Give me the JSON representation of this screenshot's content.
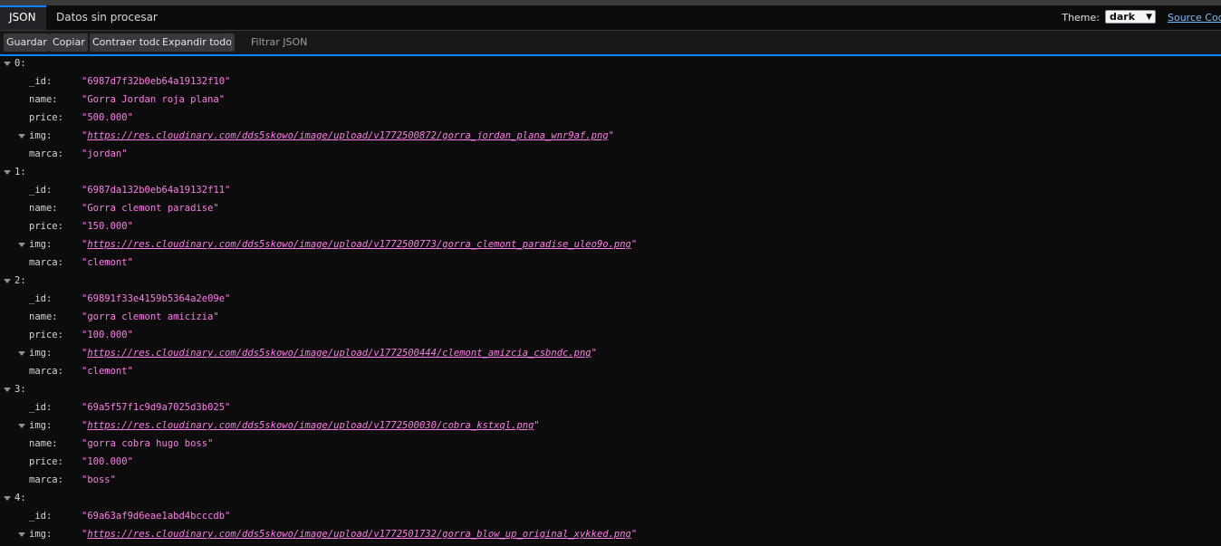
{
  "tabs": [
    {
      "label": "JSON",
      "active": true
    },
    {
      "label": "Datos sin procesar",
      "active": false
    }
  ],
  "header": {
    "theme_label": "Theme:",
    "theme_value": "dark",
    "source_link": "Source Code"
  },
  "toolbar": {
    "save_label": "Guardar",
    "copy_label": "Copiar",
    "collapse_label": "Contraer todo",
    "expand_label": "Expandir todo",
    "filter_placeholder": "Filtrar JSON"
  },
  "colors": {
    "accent": "#0a84ff",
    "string_value": "#ff7de9",
    "background": "#0c0c0d"
  },
  "items": [
    {
      "index": "0:",
      "fields": [
        {
          "key": "_id:",
          "value": "\"6987d7f32b0eb64a19132f10\"",
          "link": false
        },
        {
          "key": "name:",
          "value": "\"Gorra Jordan roja plana\"",
          "link": false
        },
        {
          "key": "price:",
          "value": "\"500.000\"",
          "link": false
        },
        {
          "key": "img:",
          "value": "https://res.cloudinary.com/dds5skowo/image/upload/v1772500872/gorra_jordan_plana_wnr9af.png",
          "link": true
        },
        {
          "key": "marca:",
          "value": "\"jordan\"",
          "link": false
        }
      ]
    },
    {
      "index": "1:",
      "fields": [
        {
          "key": "_id:",
          "value": "\"6987da132b0eb64a19132f11\"",
          "link": false
        },
        {
          "key": "name:",
          "value": "\"Gorra clemont paradise\"",
          "link": false
        },
        {
          "key": "price:",
          "value": "\"150.000\"",
          "link": false
        },
        {
          "key": "img:",
          "value": "https://res.cloudinary.com/dds5skowo/image/upload/v1772500773/gorra_clemont_paradise_uleo9o.png",
          "link": true
        },
        {
          "key": "marca:",
          "value": "\"clemont\"",
          "link": false
        }
      ]
    },
    {
      "index": "2:",
      "fields": [
        {
          "key": "_id:",
          "value": "\"69891f33e4159b5364a2e09e\"",
          "link": false
        },
        {
          "key": "name:",
          "value": "\"gorra clemont amicizia\"",
          "link": false
        },
        {
          "key": "price:",
          "value": "\"100.000\"",
          "link": false
        },
        {
          "key": "img:",
          "value": "https://res.cloudinary.com/dds5skowo/image/upload/v1772500444/clemont_amizcia_csbndc.png",
          "link": true
        },
        {
          "key": "marca:",
          "value": "\"clemont\"",
          "link": false
        }
      ]
    },
    {
      "index": "3:",
      "fields": [
        {
          "key": "_id:",
          "value": "\"69a5f57f1c9d9a7025d3b025\"",
          "link": false
        },
        {
          "key": "img:",
          "value": "https://res.cloudinary.com/dds5skowo/image/upload/v1772500030/cobra_kstxql.png",
          "link": true
        },
        {
          "key": "name:",
          "value": "\"gorra cobra hugo boss\"",
          "link": false
        },
        {
          "key": "price:",
          "value": "\"100.000\"",
          "link": false
        },
        {
          "key": "marca:",
          "value": "\"boss\"",
          "link": false
        }
      ]
    },
    {
      "index": "4:",
      "fields": [
        {
          "key": "_id:",
          "value": "\"69a63af9d6eae1abd4bcccdb\"",
          "link": false
        },
        {
          "key": "img:",
          "value": "https://res.cloudinary.com/dds5skowo/image/upload/v1772501732/gorra_blow_up_original_xykked.png",
          "link": true
        }
      ]
    }
  ]
}
